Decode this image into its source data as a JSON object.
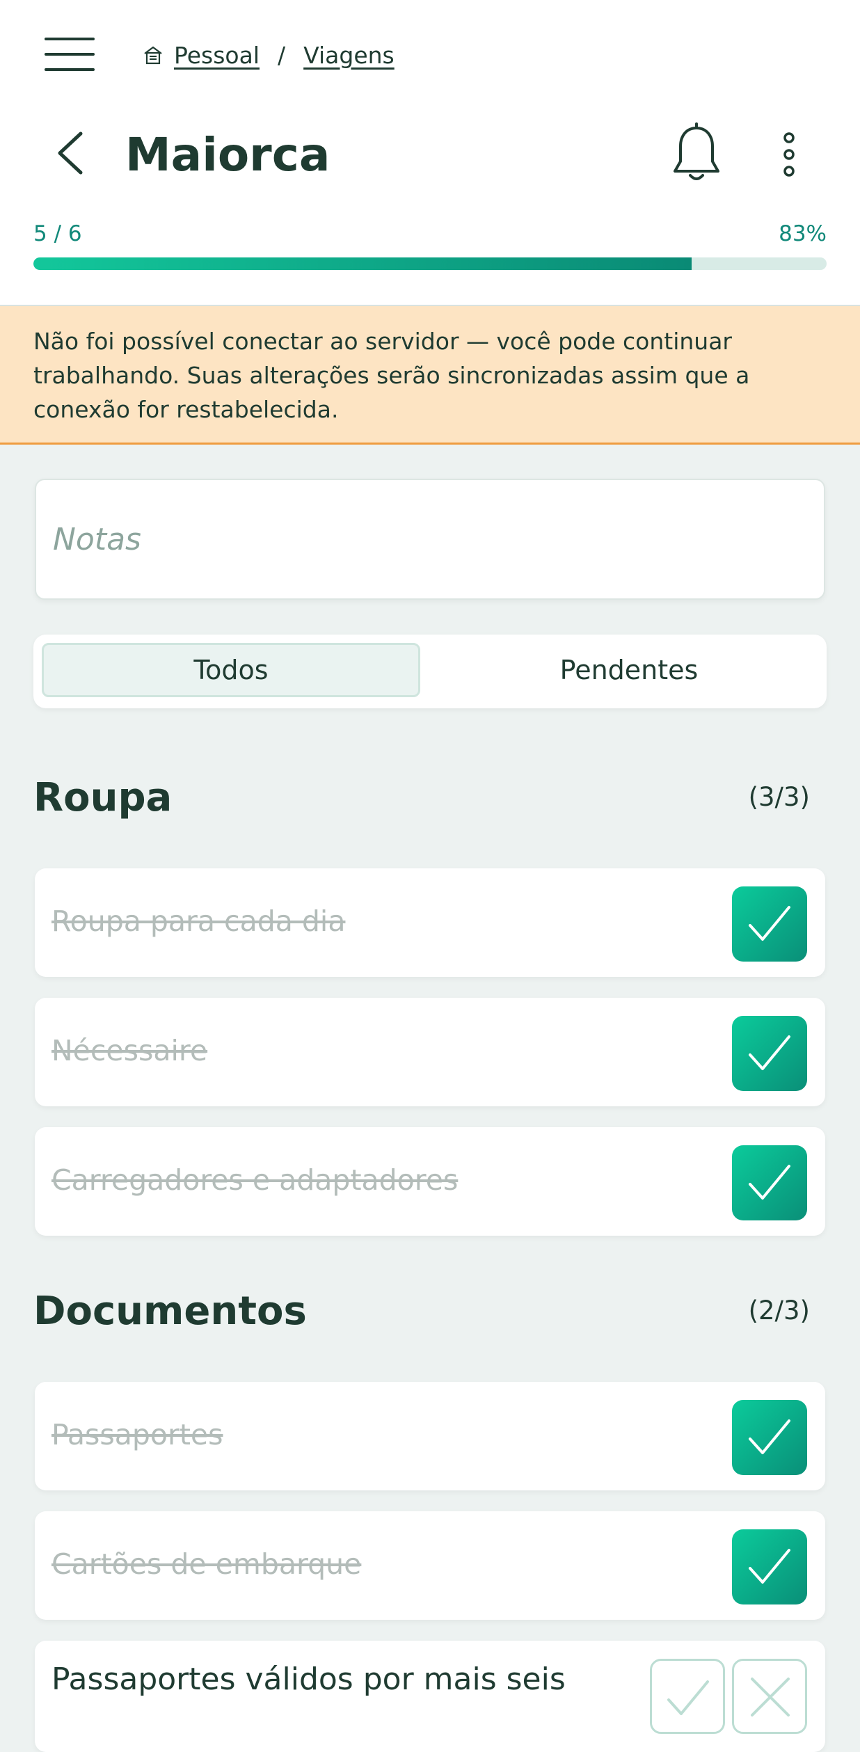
{
  "header": {
    "breadcrumb": [
      "Pessoal",
      "Viagens"
    ],
    "breadcrumb_separator": "/",
    "title": "Maiorca"
  },
  "progress": {
    "count_text": "5 / 6",
    "percent_text": "83%",
    "fraction": 0.83
  },
  "banner": {
    "message": "Não foi possível conectar ao servidor — você pode continuar trabalhando. Suas alterações serão sincronizadas assim que a conexão for restabelecida."
  },
  "notes": {
    "placeholder": "Notas"
  },
  "filter": {
    "all_label": "Todos",
    "pending_label": "Pendentes",
    "selected": "Todos"
  },
  "sections": [
    {
      "title": "Roupa",
      "count": "(3/3)",
      "items": [
        {
          "label": "Roupa para cada dia",
          "done": true
        },
        {
          "label": "Nécessaire",
          "done": true
        },
        {
          "label": "Carregadores e adaptadores",
          "done": true
        }
      ]
    },
    {
      "title": "Documentos",
      "count": "(2/3)",
      "items": [
        {
          "label": "Passaportes",
          "done": true
        },
        {
          "label": "Cartões de embarque",
          "done": true
        },
        {
          "label": "Passaportes válidos por mais seis",
          "done": false
        }
      ]
    }
  ],
  "colors": {
    "accent": "#0a8f78",
    "accent_light": "#0bcb9b",
    "text": "#1f3b31",
    "banner_bg": "#fde4c3",
    "banner_border": "#ef9c40",
    "page_bg": "#edf2f1"
  },
  "icons": [
    "menu-icon",
    "home-icon",
    "back-arrow-icon",
    "bell-icon",
    "more-vertical-icon",
    "check-icon",
    "close-icon"
  ]
}
